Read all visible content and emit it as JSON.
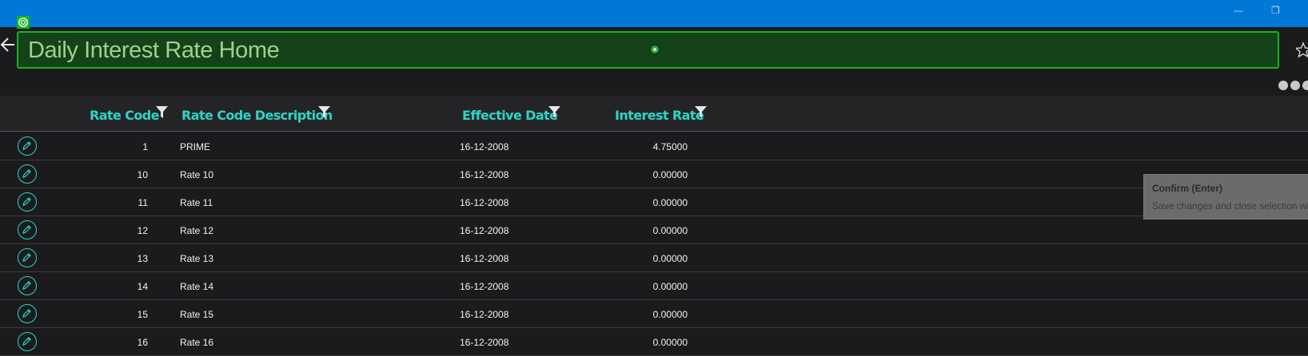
{
  "window": {
    "minimize_glyph": "—",
    "restore_glyph": "❐"
  },
  "header": {
    "title": "Daily Interest Rate Home",
    "back_icon": "back-arrow-icon",
    "favorite_icon": "star-icon",
    "more_icon": "more-dots-icon"
  },
  "table": {
    "columns": [
      {
        "label": "Rate Code",
        "filter_icon": "filter-icon"
      },
      {
        "label": "Rate Code Description",
        "filter_icon": "filter-icon"
      },
      {
        "label": "Effective Date",
        "filter_icon": "filter-icon"
      },
      {
        "label": "Interest Rate",
        "filter_icon": "filter-icon"
      }
    ],
    "rows": [
      {
        "code": "1",
        "description": "PRIME",
        "date": "16-12-2008",
        "rate": "4.75000"
      },
      {
        "code": "10",
        "description": "Rate 10",
        "date": "16-12-2008",
        "rate": "0.00000"
      },
      {
        "code": "11",
        "description": "Rate 11",
        "date": "16-12-2008",
        "rate": "0.00000"
      },
      {
        "code": "12",
        "description": "Rate 12",
        "date": "16-12-2008",
        "rate": "0.00000"
      },
      {
        "code": "13",
        "description": "Rate 13",
        "date": "16-12-2008",
        "rate": "0.00000"
      },
      {
        "code": "14",
        "description": "Rate 14",
        "date": "16-12-2008",
        "rate": "0.00000"
      },
      {
        "code": "15",
        "description": "Rate 15",
        "date": "16-12-2008",
        "rate": "0.00000"
      },
      {
        "code": "16",
        "description": "Rate 16",
        "date": "16-12-2008",
        "rate": "0.00000"
      }
    ]
  },
  "tooltip": {
    "title": "Confirm (Enter)",
    "body": "Save changes and close selection wiz"
  },
  "colors": {
    "titlebar": "#0078d7",
    "accent_teal": "#2bd6c8",
    "title_box_border": "#17b321",
    "title_box_fill": "#14431a",
    "title_text": "#9fd28c",
    "background": "#1b1b1d"
  }
}
